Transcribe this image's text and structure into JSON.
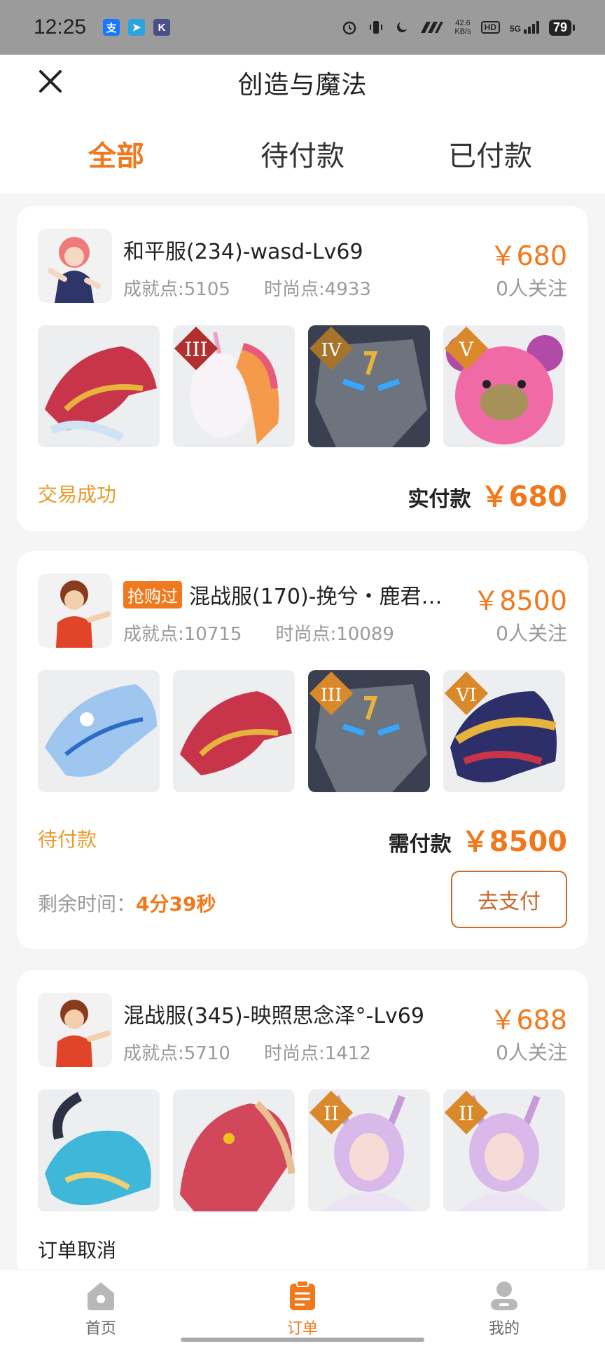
{
  "status_bar": {
    "time": "12:25",
    "app_icons": [
      {
        "name": "alipay-icon",
        "glyph": "支",
        "color": "#1677ff"
      },
      {
        "name": "telegram-icon",
        "glyph": "➤",
        "color": "#2aa3e0"
      },
      {
        "name": "k-app-icon",
        "glyph": "K",
        "color": "#4a4f8a"
      }
    ],
    "net_speed_value": "42.6",
    "net_speed_unit": "KB/s",
    "hd": "HD",
    "network": "5G",
    "battery": "79"
  },
  "header": {
    "title": "创造与魔法",
    "tabs": [
      {
        "label": "全部",
        "active": true
      },
      {
        "label": "待付款",
        "active": false
      },
      {
        "label": "已付款",
        "active": false
      }
    ]
  },
  "orders": [
    {
      "rush_tag": "",
      "server": "和平服(234)-wasd-Lv69",
      "achievement": "成就点:5105",
      "fashion": "时尚点:4933",
      "price": "￥680",
      "followers": "0人关注",
      "items": [
        {
          "name": "red-dragon-mount",
          "tier": ""
        },
        {
          "name": "unicorn-mount",
          "tier": "III"
        },
        {
          "name": "mecha-mount",
          "tier": "IV"
        },
        {
          "name": "pink-bear-mount",
          "tier": "V"
        }
      ],
      "status": "交易成功",
      "pay_label": "实付款",
      "pay_amount": "￥680"
    },
    {
      "rush_tag": "抢购过",
      "server": "混战服(170)-挽兮・鹿君…",
      "achievement": "成就点:10715",
      "fashion": "时尚点:10089",
      "price": "￥8500",
      "followers": "0人关注",
      "items": [
        {
          "name": "ice-dragon-mount",
          "tier": ""
        },
        {
          "name": "red-dragon-mount",
          "tier": ""
        },
        {
          "name": "mecha-mount",
          "tier": "III"
        },
        {
          "name": "gold-dragon-mount",
          "tier": "VI"
        }
      ],
      "status": "待付款",
      "pay_label": "需付款",
      "pay_amount": "￥8500",
      "remaining_label": "剩余时间：",
      "remaining_time": "4分39秒",
      "pay_button": "去支付"
    },
    {
      "rush_tag": "",
      "server": "混战服(345)-映照思念泽°-Lv69",
      "achievement": "成就点:5710",
      "fashion": "时尚点:1412",
      "price": "￥688",
      "followers": "0人关注",
      "items": [
        {
          "name": "blue-dragon-mount",
          "tier": ""
        },
        {
          "name": "red-lizard-mount",
          "tier": ""
        },
        {
          "name": "fox-girl-skin",
          "tier": "II"
        },
        {
          "name": "fox-girl-skin",
          "tier": "II"
        }
      ],
      "status": "订单取消"
    }
  ],
  "bottom_nav": [
    {
      "label": "首页",
      "icon": "home-icon",
      "active": false
    },
    {
      "label": "订单",
      "icon": "order-icon",
      "active": true
    },
    {
      "label": "我的",
      "icon": "profile-icon",
      "active": false
    }
  ],
  "colors": {
    "accent": "#f0791d",
    "status_success": "#e89b2a",
    "muted": "#9a9a9a"
  }
}
